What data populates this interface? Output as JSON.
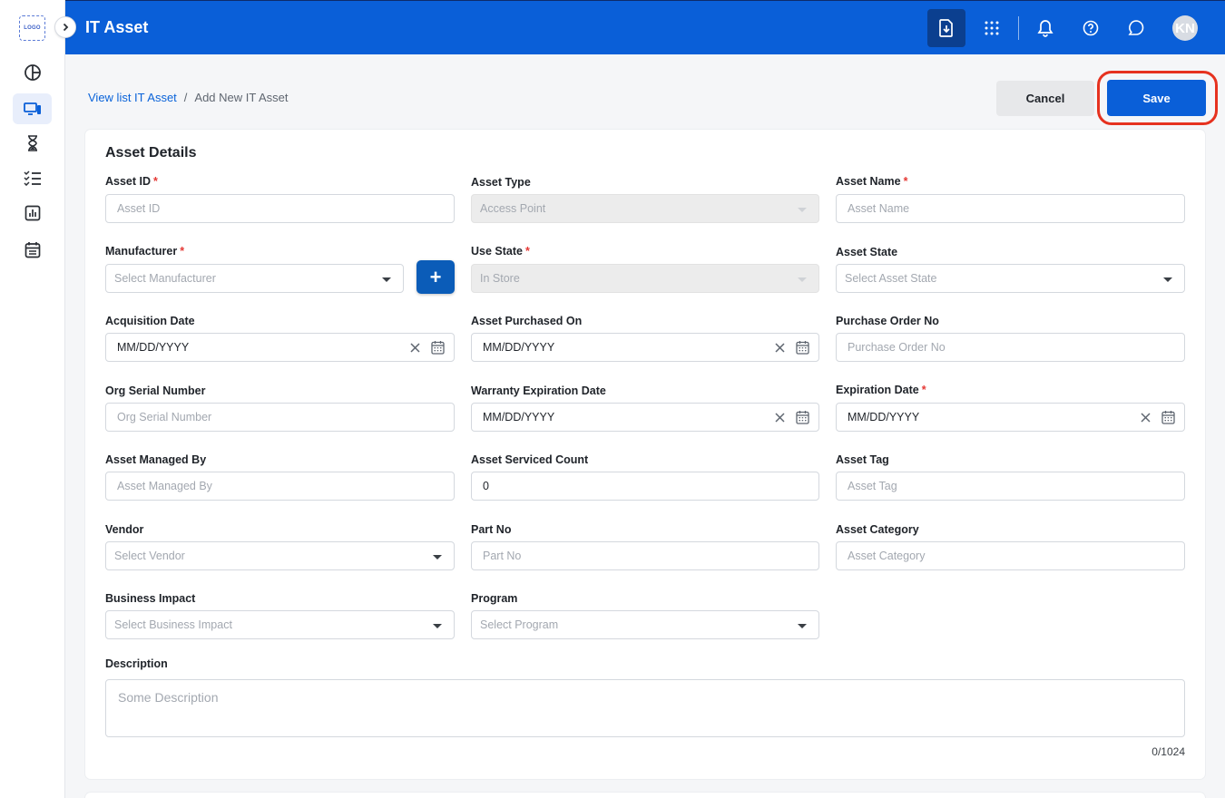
{
  "sidebar": {
    "logo_text": "LOGO",
    "items": [
      {
        "icon": "dashboard-icon"
      },
      {
        "icon": "assets-icon",
        "active": true
      },
      {
        "icon": "hourglass-icon"
      },
      {
        "icon": "checklist-icon"
      },
      {
        "icon": "reports-icon"
      },
      {
        "icon": "calendar-icon"
      }
    ]
  },
  "header": {
    "title": "IT Asset",
    "avatar_initials": "KN",
    "icons": [
      "download-icon",
      "apps-grid-icon",
      "bell-icon",
      "help-icon",
      "chat-icon"
    ]
  },
  "breadcrumb": {
    "parent": "View list IT Asset",
    "separator": "/",
    "current": "Add New IT Asset"
  },
  "actions": {
    "cancel": "Cancel",
    "save": "Save"
  },
  "form": {
    "section_title": "Asset Details",
    "asset_id": {
      "label": "Asset ID",
      "required": "*",
      "placeholder": "Asset ID"
    },
    "asset_type": {
      "label": "Asset Type",
      "value": "Access Point"
    },
    "asset_name": {
      "label": "Asset Name",
      "required": "*",
      "placeholder": "Asset Name"
    },
    "manufacturer": {
      "label": "Manufacturer",
      "required": "*",
      "placeholder": "Select Manufacturer",
      "add_label": "+"
    },
    "use_state": {
      "label": "Use State",
      "required": "*",
      "value": "In Store"
    },
    "asset_state": {
      "label": "Asset State",
      "placeholder": "Select Asset State"
    },
    "acquisition_date": {
      "label": "Acquisition Date",
      "value": "MM/DD/YYYY"
    },
    "asset_purchased_on": {
      "label": "Asset Purchased On",
      "value": "MM/DD/YYYY"
    },
    "purchase_order_no": {
      "label": "Purchase Order No",
      "placeholder": "Purchase Order No"
    },
    "org_serial_number": {
      "label": "Org Serial Number",
      "placeholder": "Org Serial Number"
    },
    "warranty_expiration_date": {
      "label": "Warranty Expiration Date",
      "value": "MM/DD/YYYY"
    },
    "expiration_date": {
      "label": "Expiration Date",
      "required": "*",
      "value": "MM/DD/YYYY"
    },
    "asset_managed_by": {
      "label": "Asset Managed By",
      "placeholder": "Asset Managed By"
    },
    "asset_serviced_count": {
      "label": "Asset Serviced Count",
      "value": "0"
    },
    "asset_tag": {
      "label": "Asset Tag",
      "placeholder": "Asset Tag"
    },
    "vendor": {
      "label": "Vendor",
      "placeholder": "Select Vendor"
    },
    "part_no": {
      "label": "Part No",
      "placeholder": "Part No"
    },
    "asset_category": {
      "label": "Asset Category",
      "placeholder": "Asset Category"
    },
    "business_impact": {
      "label": "Business Impact",
      "placeholder": "Select Business Impact"
    },
    "program": {
      "label": "Program",
      "placeholder": "Select Program"
    },
    "description": {
      "label": "Description",
      "placeholder": "Some Description",
      "counter": "0/1024"
    }
  },
  "colors": {
    "header": "#0a5fd8",
    "primary_button": "#0a5fd8",
    "highlight": "#e6321f",
    "required": "#e53935"
  }
}
